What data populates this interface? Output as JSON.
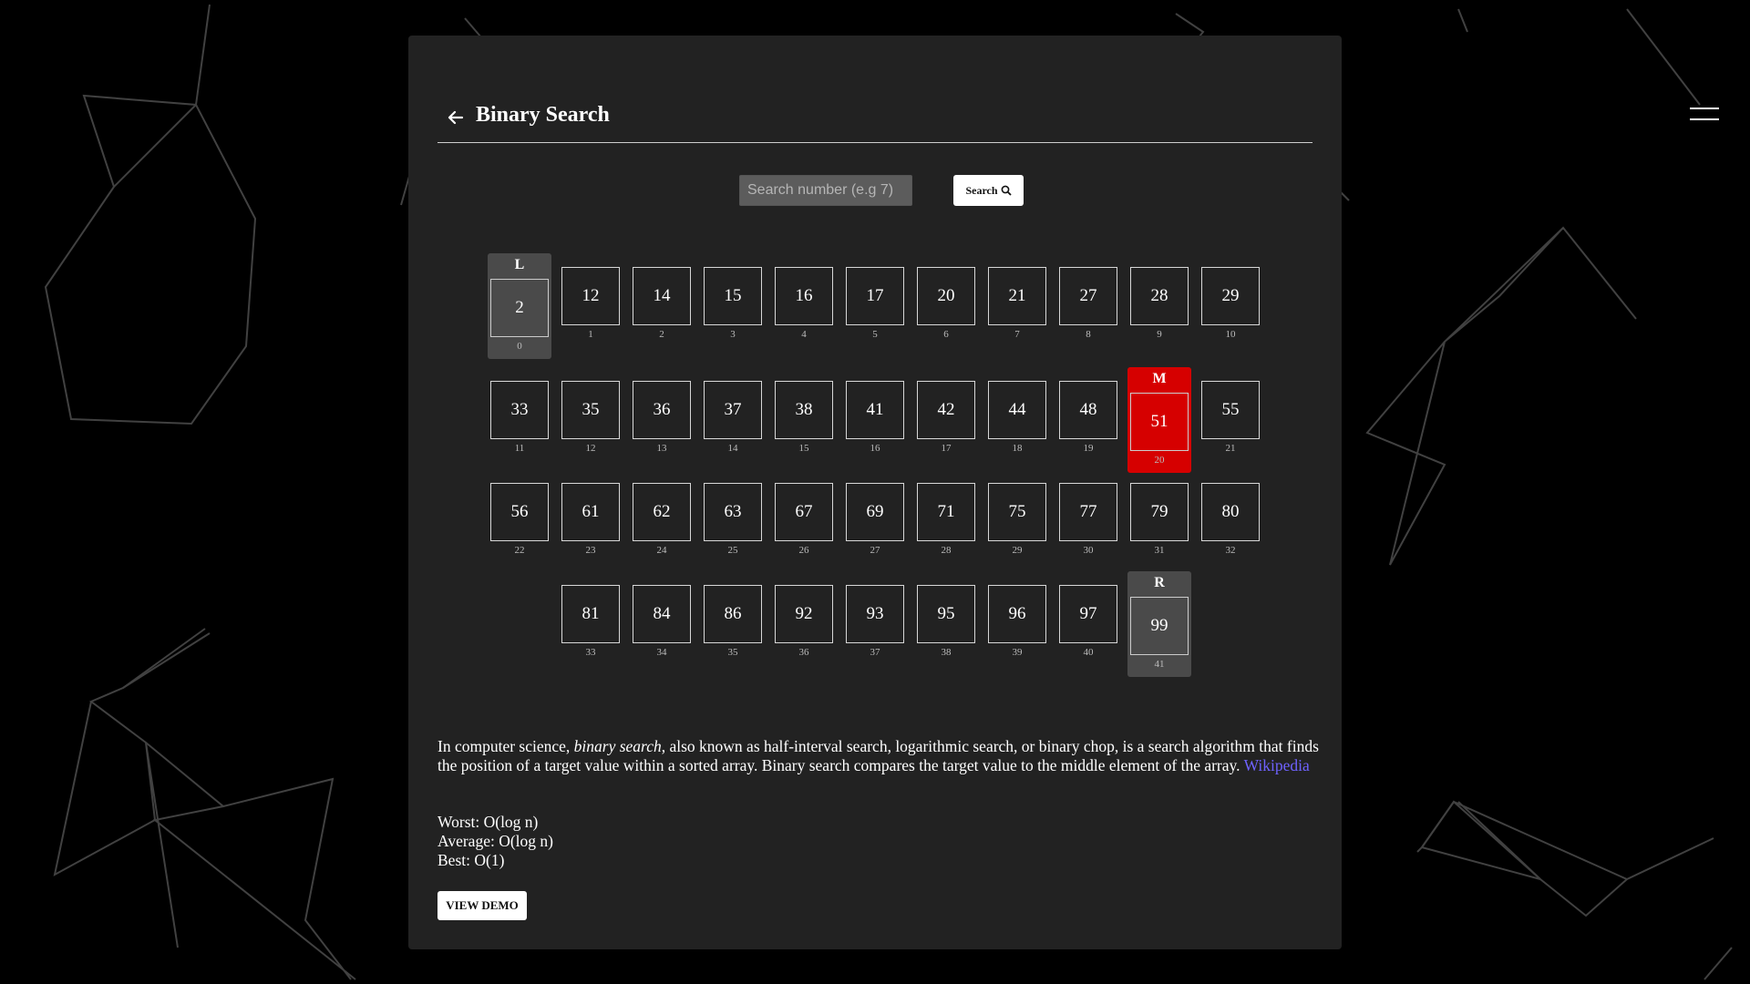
{
  "header": {
    "title": "Binary Search"
  },
  "search": {
    "placeholder": "Search number (e.g 7)",
    "value": "",
    "button_label": "Search"
  },
  "array": {
    "values": [
      2,
      12,
      14,
      15,
      16,
      17,
      20,
      21,
      27,
      28,
      29,
      33,
      35,
      36,
      37,
      38,
      41,
      42,
      44,
      48,
      51,
      55,
      56,
      61,
      62,
      63,
      67,
      69,
      71,
      75,
      77,
      79,
      80,
      81,
      84,
      86,
      92,
      93,
      95,
      96,
      97,
      99
    ],
    "markers": [
      {
        "label": "L",
        "index": 0,
        "style": "gray"
      },
      {
        "label": "M",
        "index": 20,
        "style": "red"
      },
      {
        "label": "R",
        "index": 41,
        "style": "gray"
      }
    ]
  },
  "description": {
    "prefix": "In computer science, ",
    "term": "binary search",
    "body": ", also known as half-interval search, logarithmic search, or binary chop, is a search algorithm that finds the position of a target value within a sorted array. Binary search compares the target value to the middle element of the array.",
    "link_label": "Wikipedia"
  },
  "complexity": {
    "worst": "Worst: O(log n)",
    "average": "Average: O(log n)",
    "best": "Best: O(1)"
  },
  "demo": {
    "button_label": "VIEW DEMO"
  },
  "colors": {
    "panel": "#222222",
    "highlight": "#d60000",
    "bound": "#4a4a4a",
    "link": "#6f62ff"
  },
  "icons": {
    "back": "arrow-left-icon",
    "search": "magnifier-icon",
    "menu": "hamburger-icon"
  }
}
